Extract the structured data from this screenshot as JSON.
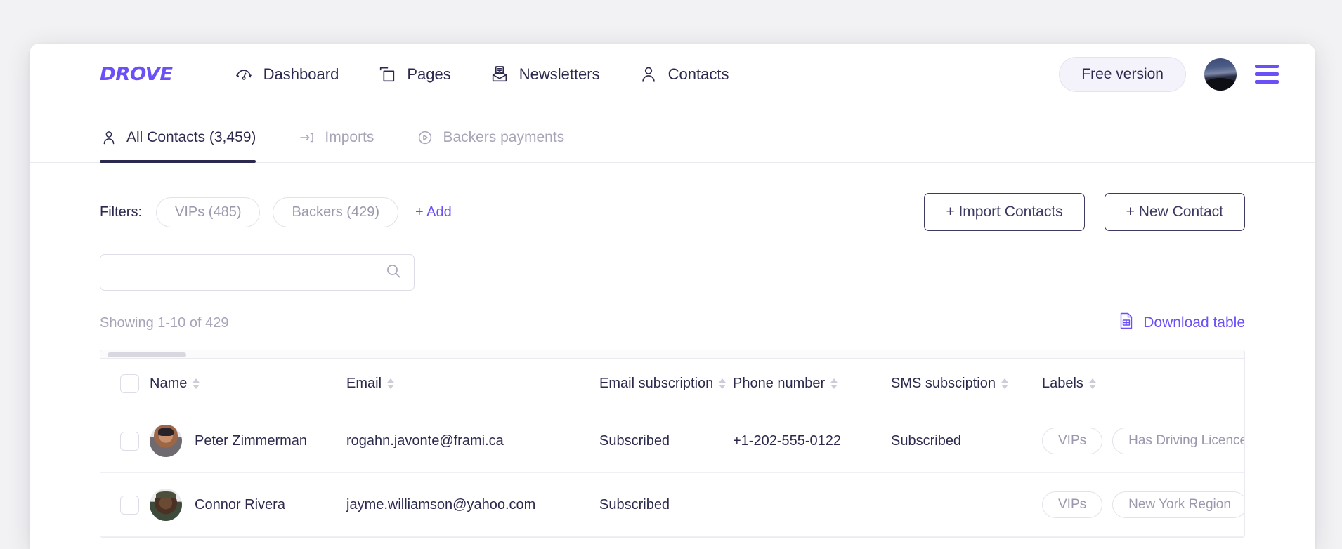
{
  "brand": {
    "name": "DROVE",
    "color": "#6c4ff7"
  },
  "topnav": {
    "items": [
      {
        "label": "Dashboard",
        "icon": "gauge-icon"
      },
      {
        "label": "Pages",
        "icon": "pages-icon"
      },
      {
        "label": "Newsletters",
        "icon": "newsletter-icon"
      },
      {
        "label": "Contacts",
        "icon": "person-icon"
      }
    ],
    "plan_badge": "Free version",
    "avatar_alt": "user-avatar",
    "menu_icon": "hamburger-icon"
  },
  "tabs": [
    {
      "label": "All Contacts (3,459)",
      "icon": "person-icon",
      "active": true
    },
    {
      "label": "Imports",
      "icon": "import-arrow-icon",
      "active": false
    },
    {
      "label": "Backers payments",
      "icon": "play-circle-icon",
      "active": false
    }
  ],
  "filters": {
    "label": "Filters:",
    "chips": [
      "VIPs (485)",
      "Backers (429)"
    ],
    "add_label": "+ Add"
  },
  "actions": {
    "import_label": "+ Import Contacts",
    "new_contact_label": "+ New Contact"
  },
  "search": {
    "value": "",
    "placeholder": "",
    "icon": "search-icon"
  },
  "results": {
    "showing_text": "Showing 1-10 of 429",
    "download_label": "Download table",
    "download_icon": "table-document-icon"
  },
  "table": {
    "columns": [
      {
        "key": "check",
        "label": "",
        "sortable": false
      },
      {
        "key": "name",
        "label": "Name",
        "sortable": true
      },
      {
        "key": "email",
        "label": "Email",
        "sortable": true
      },
      {
        "key": "esub",
        "label": "Email subscription",
        "sortable": true
      },
      {
        "key": "phone",
        "label": "Phone number",
        "sortable": true
      },
      {
        "key": "ssub",
        "label": "SMS subsciption",
        "sortable": true
      },
      {
        "key": "labels",
        "label": "Labels",
        "sortable": true
      }
    ],
    "rows": [
      {
        "name": "Peter Zimmerman",
        "email": "rogahn.javonte@frami.ca",
        "email_subscription": "Subscribed",
        "phone_number": "+1-202-555-0122",
        "sms_subscription": "Subscribed",
        "labels": [
          "VIPs",
          "Has Driving Licence"
        ],
        "avatar": "portrait-1"
      },
      {
        "name": "Connor Rivera",
        "email": "jayme.williamson@yahoo.com",
        "email_subscription": "Subscribed",
        "phone_number": "",
        "sms_subscription": "",
        "labels": [
          "VIPs",
          "New York Region"
        ],
        "avatar": "portrait-2"
      }
    ]
  }
}
